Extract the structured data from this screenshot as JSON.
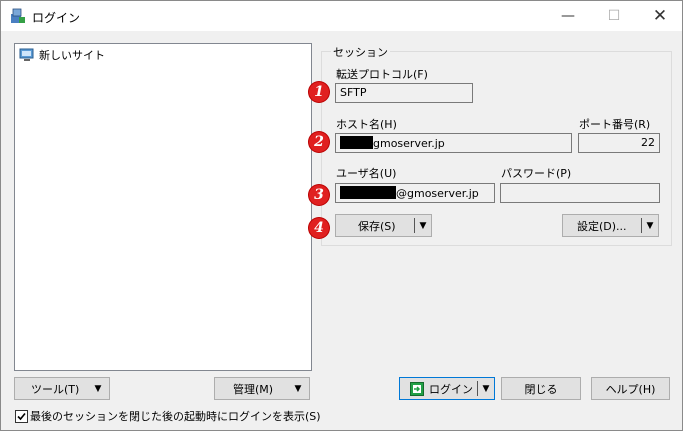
{
  "window": {
    "title": "ログイン"
  },
  "tree": {
    "items": [
      {
        "label": "新しいサイト"
      }
    ]
  },
  "left_buttons": {
    "tools": "ツール(T)",
    "manage": "管理(M)"
  },
  "session": {
    "group_label": "セッション",
    "protocol_label": "転送プロトコル(F)",
    "protocol_value": "SFTP",
    "host_label": "ホスト名(H)",
    "host_value": "gmoserver.jp",
    "port_label": "ポート番号(R)",
    "port_value": "22",
    "user_label": "ユーザ名(U)",
    "user_value": "@gmoserver.jp",
    "password_label": "パスワード(P)",
    "password_value": "",
    "save_label": "保存(S)",
    "settings_label": "設定(D)..."
  },
  "markers": [
    "1",
    "2",
    "3",
    "4"
  ],
  "bottom_buttons": {
    "login": "ログイン",
    "close": "閉じる",
    "help": "ヘルプ(H)"
  },
  "checkbox": {
    "label": "最後のセッションを閉じた後の起動時にログインを表示(S)",
    "checked": true
  },
  "colors": {
    "marker": "#e02020",
    "window_bg": "#f0f0f0",
    "button_bg": "#e1e1e1",
    "login_icon": "#22a046"
  }
}
